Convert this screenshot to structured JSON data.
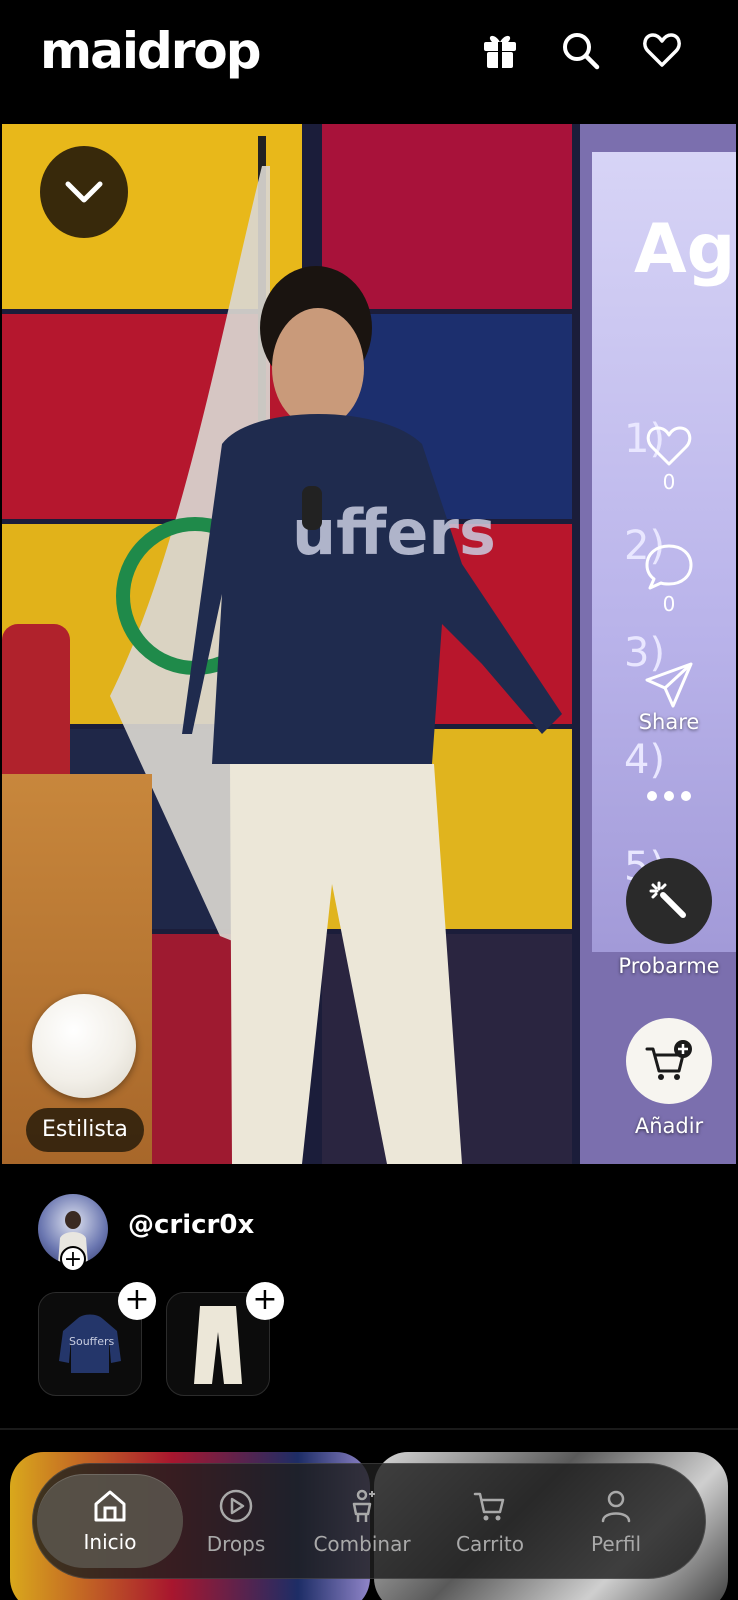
{
  "app": {
    "logo": "maidrop"
  },
  "header": {
    "icons": [
      "gift-icon",
      "search-icon",
      "heart-icon"
    ]
  },
  "video": {
    "screen_text": [
      "Ag",
      "1)",
      "2)",
      "3)",
      "4)",
      "5)"
    ],
    "actions": {
      "like_count": "0",
      "comment_count": "0",
      "share_label": "Share",
      "try_on_label": "Probarme",
      "add_label": "Añadir"
    },
    "stylist_label": "Estilista"
  },
  "creator": {
    "username": "@cricr0x",
    "products": [
      {
        "name": "hoodie",
        "print": "Souffers"
      },
      {
        "name": "pants"
      }
    ]
  },
  "nav": {
    "items": [
      {
        "label": "Inicio",
        "icon": "home-icon",
        "active": true
      },
      {
        "label": "Drops",
        "icon": "play-circle-icon",
        "active": false
      },
      {
        "label": "Combinar",
        "icon": "outfit-icon",
        "active": false
      },
      {
        "label": "Carrito",
        "icon": "cart-icon",
        "active": false
      },
      {
        "label": "Perfil",
        "icon": "user-icon",
        "active": false
      }
    ]
  },
  "colors": {
    "background": "#000000",
    "accent_dark": "#281c0a",
    "nav_bg": "#1e1e1e"
  }
}
